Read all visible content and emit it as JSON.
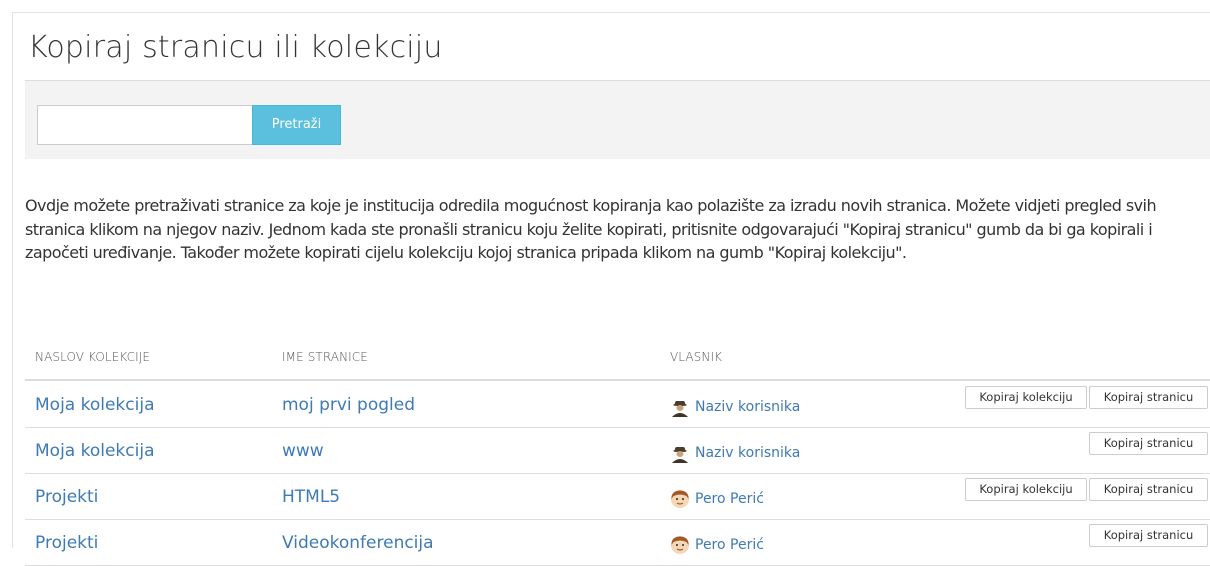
{
  "page": {
    "title": "Kopiraj stranicu ili kolekciju"
  },
  "search": {
    "value": "",
    "placeholder": "",
    "button_label": "Pretraži"
  },
  "description": "Ovdje možete pretraživati stranice za koje je institucija odredila mogućnost kopiranja kao polazište za izradu novih stranica. Možete vidjeti pregled svih stranica klikom na njegov naziv. Jednom kada ste pronašli stranicu koju želite kopirati, pritisnite odgovarajući \"Kopiraj stranicu\" gumb da bi ga kopirali i započeti uređivanje. Također možete kopirati cijelu kolekciju kojoj stranica pripada klikom na gumb \"Kopiraj kolekciju\".",
  "table": {
    "columns": {
      "collection": "Naslov kolekcije",
      "page": "Ime stranice",
      "owner": "Vlasnik"
    },
    "rows": [
      {
        "collection": "Moja kolekcija",
        "page": "moj prvi pogled",
        "owner": "Naziv korisnika",
        "avatar_icon": "user-silhouette-icon",
        "copy_collection_label": "Kopiraj kolekciju",
        "copy_page_label": "Kopiraj stranicu"
      },
      {
        "collection": "Moja kolekcija",
        "page": "www",
        "owner": "Naziv korisnika",
        "avatar_icon": "user-silhouette-icon",
        "copy_page_label": "Kopiraj stranicu"
      },
      {
        "collection": "Projekti",
        "page": "HTML5",
        "owner": "Pero Perić",
        "avatar_icon": "user-face-icon",
        "copy_collection_label": "Kopiraj kolekciju",
        "copy_page_label": "Kopiraj stranicu"
      },
      {
        "collection": "Projekti",
        "page": "Videokonferencija",
        "owner": "Pero Perić",
        "avatar_icon": "user-face-icon",
        "copy_page_label": "Kopiraj stranicu"
      }
    ]
  },
  "colors": {
    "link": "#3e7ab5",
    "search_button": "#5bc0de",
    "search_bar_bg": "#f3f3f3"
  }
}
